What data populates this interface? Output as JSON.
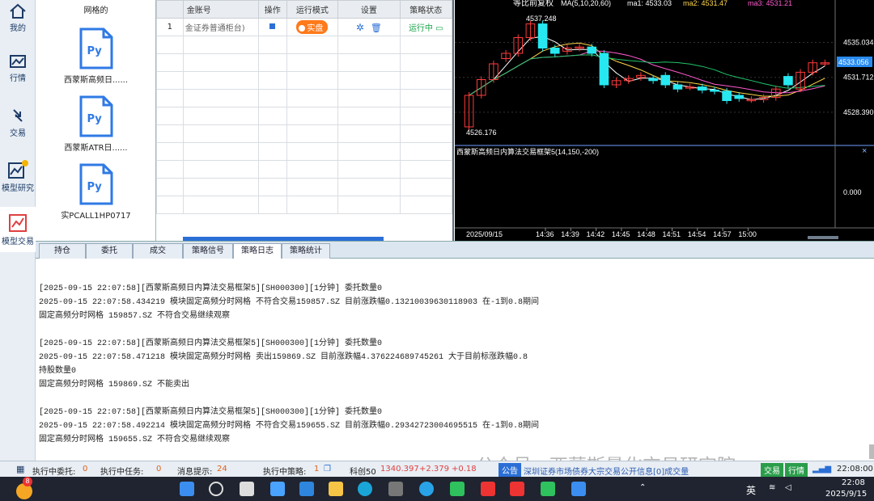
{
  "nav": {
    "items": [
      {
        "label": "我的",
        "icon": "home-icon"
      },
      {
        "label": "行情",
        "icon": "chart-icon"
      },
      {
        "label": "交易",
        "icon": "trade-arrows-icon"
      },
      {
        "label": "模型研究",
        "icon": "model-research-icon"
      },
      {
        "label": "模型交易",
        "icon": "model-trade-icon"
      }
    ]
  },
  "files": {
    "header": "网格的",
    "items": [
      {
        "name": "西蒙斯高频日......",
        "badge": "Py"
      },
      {
        "name": "西蒙斯ATR日......",
        "badge": "Py"
      },
      {
        "name": "实PCALL1HP0717",
        "badge": "Py"
      }
    ]
  },
  "table": {
    "columns": [
      "",
      "金账号",
      "操作",
      "运行模式",
      "设置",
      "策略状态"
    ],
    "rows": [
      {
        "index": "1",
        "account": "金证券普通柜台)",
        "mode": "实盘",
        "status": "运行中"
      }
    ]
  },
  "chart": {
    "title": "等比前复权",
    "ma_label": "MA(5,10,20,60)",
    "ma1": "ma1: 4533.03",
    "ma2": "ma2: 4531.47",
    "ma3": "ma3: 4531.21",
    "high_label": "4537.248",
    "low_label": "4526.176",
    "price_ticks": [
      "4535.034",
      "4531.712",
      "4528.390"
    ],
    "current_price": "4533.056",
    "indicator_title": "西蒙斯高频日内算法交易框架5(14,150,-200)",
    "indicator_tick": "0.000",
    "date_label": "2025/09/15",
    "time_ticks": [
      "14:36",
      "14:39",
      "14:42",
      "14:45",
      "14:48",
      "14:51",
      "14:54",
      "14:57",
      "15:00"
    ]
  },
  "chart_data": {
    "type": "candlestick",
    "x": [
      "14:31",
      "14:32",
      "14:33",
      "14:34",
      "14:35",
      "14:36",
      "14:37",
      "14:38",
      "14:39",
      "14:40",
      "14:41",
      "14:42",
      "14:43",
      "14:44",
      "14:45",
      "14:46",
      "14:47",
      "14:48",
      "14:49",
      "14:50",
      "14:51",
      "14:52",
      "14:53",
      "14:54",
      "14:55",
      "14:56",
      "14:57",
      "14:58",
      "14:59",
      "15:00"
    ],
    "open": [
      4527.0,
      4530.0,
      4531.5,
      4533.5,
      4534.0,
      4535.5,
      4536.8,
      4534.5,
      4534.2,
      4534.5,
      4534.6,
      4534.0,
      4531.0,
      4531.4,
      4531.7,
      4531.6,
      4531.9,
      4531.0,
      4530.8,
      4530.8,
      4530.5,
      4530.4,
      4530.0,
      4529.6,
      4529.6,
      4529.8,
      4531.8,
      4530.6,
      4532.2,
      4533.1
    ],
    "close": [
      4530.0,
      4531.5,
      4533.0,
      4534.0,
      4535.5,
      4536.8,
      4534.5,
      4534.0,
      4534.5,
      4534.6,
      4534.0,
      4531.0,
      4531.4,
      4531.6,
      4531.9,
      4531.4,
      4531.0,
      4530.6,
      4530.8,
      4530.5,
      4530.4,
      4529.5,
      4529.7,
      4529.6,
      4529.8,
      4530.6,
      4531.0,
      4532.2,
      4533.1,
      4533.1
    ],
    "ylim": [
      4526.0,
      4538.0
    ],
    "series_colors": {
      "up": "#ff3b3b",
      "down": "#27e8f0",
      "ma1": "#ffffff",
      "ma2": "#ffd84a",
      "ma3": "#ff5ad0",
      "ma4": "#21c46b"
    }
  },
  "tabs": {
    "items": [
      "持仓",
      "委托",
      "成交",
      "策略信号",
      "策略日志",
      "策略统计"
    ],
    "active": "策略日志"
  },
  "log": {
    "lines": [
      "[2025-09-15 22:07:58][西蒙斯高频日内算法交易框架5][SH000300][1分钟] 委托数量0",
      "2025-09-15 22:07:58.434219 模块固定高频分时网格 不符合交易159857.SZ  目前涨跌幅0.13210039630118903 在-1到0.8期间",
      "固定高频分时网格 159857.SZ 不符合交易继续观察",
      "",
      "[2025-09-15 22:07:58][西蒙斯高频日内算法交易框架5][SH000300][1分钟] 委托数量0",
      "2025-09-15 22:07:58.471218 模块固定高频分时网格 卖出159869.SZ  目前涨跌幅4.376224689745261 大于目前标涨跌幅0.8",
      "持股数量0",
      "固定高频分时网格 159869.SZ 不能卖出",
      "",
      "[2025-09-15 22:07:58][西蒙斯高频日内算法交易框架5][SH000300][1分钟] 委托数量0",
      "2025-09-15 22:07:58.492214 模块固定高频分时网格 不符合交易159655.SZ  目前涨跌幅0.29342723004695515 在-1到0.8期间",
      "固定高频分时网格 159655.SZ 不符合交易继续观察"
    ]
  },
  "status": {
    "exec_orders_label": "执行中委托:",
    "exec_orders": "0",
    "exec_tasks_label": "执行中任务:",
    "exec_tasks": "0",
    "msg_label": "消息提示:",
    "msg": "24",
    "exec_strategy_label": "执行中策略:",
    "exec_strategy": "1",
    "index_name": "科创50",
    "index_value": "1340.397",
    "index_change": "+2.379",
    "index_pct": "+0.18",
    "notice_label": "公告",
    "notice_text": "深圳证券市场债券大宗交易公开信息[0]成交量",
    "watermark": "公众号 · 西蒙斯量化交易研究院",
    "btn_trade": "交易",
    "btn_quote": "行情",
    "clock": "22:08:00"
  },
  "taskbar": {
    "time": "22:08",
    "date": "2025/9/15",
    "lang": "英",
    "badge": "8"
  }
}
